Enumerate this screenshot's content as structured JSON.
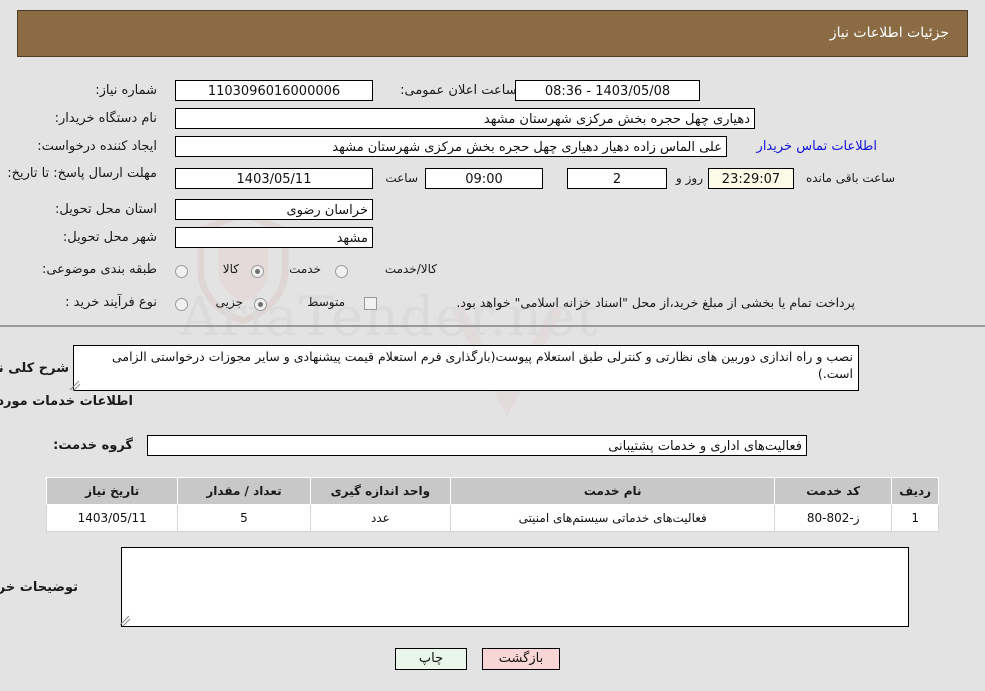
{
  "header": {
    "title": "جزئیات اطلاعات نیاز",
    "bg_color": "#8a6b44"
  },
  "fields": {
    "need_number_label": "شماره نیاز:",
    "need_number_value": "1103096016000006",
    "public_announce_label": "تاریخ و ساعت اعلان عمومی:",
    "public_announce_value": "08:36 - 1403/05/08",
    "buyer_org_label": "نام دستگاه خریدار:",
    "buyer_org_value": "دهیاری چهل حجره بخش مرکزی شهرستان مشهد",
    "requester_label": "ایجاد کننده درخواست:",
    "requester_value": "علی الماس زاده دهیار دهیاری چهل حجره بخش مرکزی شهرستان مشهد",
    "contact_link": "اطلاعات تماس خریدار",
    "deadline_label": "مهلت ارسال پاسخ: تا تاریخ:",
    "deadline_date": "1403/05/11",
    "deadline_time_label": "ساعت",
    "deadline_time": "09:00",
    "days_left": "2",
    "days_and_label": "روز و",
    "hours_left": "23:29:07",
    "hours_left_label": "ساعت باقی مانده",
    "province_label": "استان محل تحویل:",
    "province_value": "خراسان رضوی",
    "city_label": "شهر محل تحویل:",
    "city_value": "مشهد",
    "category_label": "طبقه بندی موضوعی:",
    "process_label": "نوع فرآیند خرید :",
    "treasury_note": "پرداخت تمام یا بخشی از مبلغ خرید،از محل \"اسناد خزانه اسلامی\" خواهد بود."
  },
  "category_options": [
    {
      "label": "کالا",
      "selected": false
    },
    {
      "label": "خدمت",
      "selected": true
    },
    {
      "label": "کالا/خدمت",
      "selected": false
    }
  ],
  "process_options": [
    {
      "label": "جزیی",
      "selected": false
    },
    {
      "label": "متوسط",
      "selected": true
    }
  ],
  "treasury_checked": false,
  "description": {
    "label": "شرح کلی نیاز:",
    "value": "نصب و راه اندازی دوربین های نظارتی و کنترلی طبق استعلام پیوست(بارگذاری فرم استعلام قیمت پیشنهادی و سایر مجوزات درخواستی الزامی است.)"
  },
  "services_section": {
    "heading": "اطلاعات خدمات مورد نیاز",
    "group_label": "گروه خدمت:",
    "group_value": "فعالیت‌های اداری و خدمات پشتیبانی"
  },
  "table": {
    "headers": [
      "ردیف",
      "کد خدمت",
      "نام خدمت",
      "واحد اندازه گیری",
      "تعداد / مقدار",
      "تاریخ نیاز"
    ],
    "rows": [
      {
        "row": "1",
        "code": "ز-802-80",
        "name": "فعالیت‌های خدماتی سیستم‌های امنیتی",
        "unit": "عدد",
        "qty": "5",
        "date": "1403/05/11"
      }
    ]
  },
  "buyer_notes": {
    "label": "توضیحات خریدار:",
    "value": ""
  },
  "buttons": {
    "print": "چاپ",
    "back": "بازگشت"
  },
  "watermark": {
    "text": "AriaTender.net"
  }
}
